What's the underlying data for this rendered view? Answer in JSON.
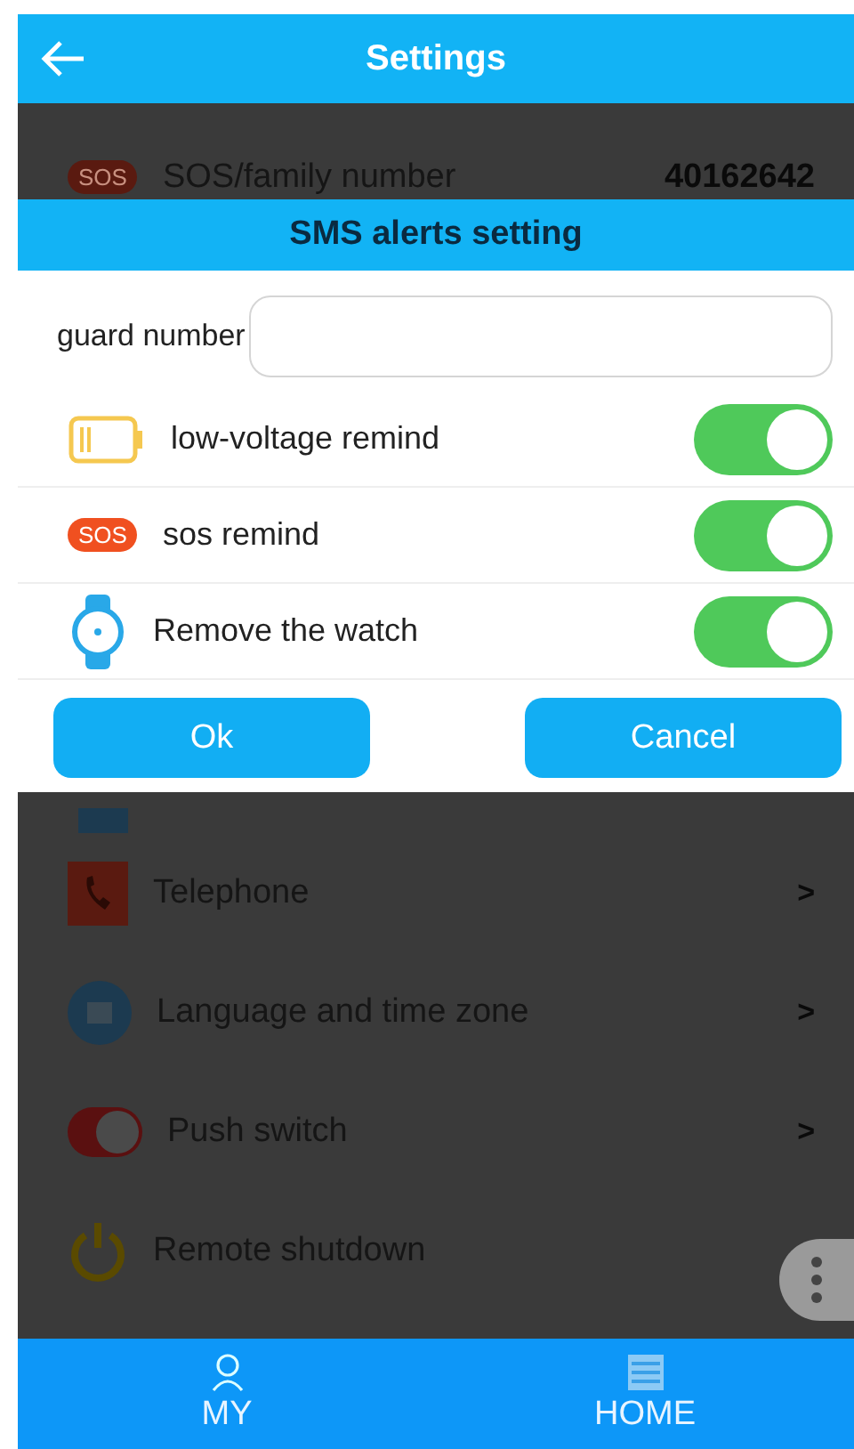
{
  "header": {
    "title": "Settings"
  },
  "list": {
    "top_row": {
      "badge": "SOS",
      "label": "SOS/family number",
      "value": "40162642"
    },
    "rows": [
      {
        "kind": "phone",
        "label": "Telephone",
        "chevron": ">"
      },
      {
        "kind": "globe",
        "label": "Language and time zone",
        "chevron": ">"
      },
      {
        "kind": "switch",
        "label": "Push switch",
        "chevron": ">"
      },
      {
        "kind": "power",
        "label": "Remote shutdown"
      }
    ]
  },
  "dialog": {
    "title": "SMS alerts setting",
    "field": {
      "label": "guard number"
    },
    "toggles": [
      {
        "kind": "battery",
        "label": "low-voltage remind",
        "on": true
      },
      {
        "kind": "sos",
        "badge": "SOS",
        "label": "sos remind",
        "on": true
      },
      {
        "kind": "watch",
        "label": "Remove the watch",
        "on": true
      }
    ],
    "buttons": [
      "Ok",
      "Cancel"
    ]
  },
  "bottom_nav": [
    {
      "kind": "person",
      "label": "MY"
    },
    {
      "kind": "home",
      "label": "HOME"
    }
  ]
}
